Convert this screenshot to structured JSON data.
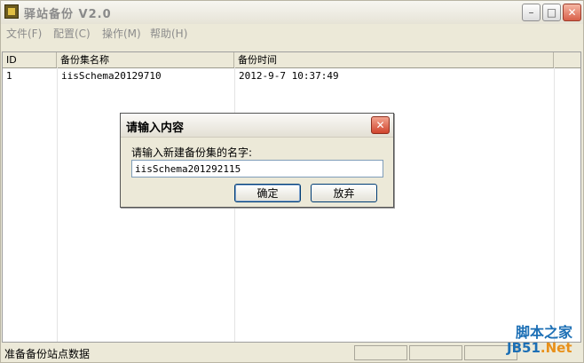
{
  "window": {
    "title": "驿站备份 V2.0"
  },
  "menu": [
    "文件(F)",
    "配置(C)",
    "操作(M)",
    "帮助(H)"
  ],
  "table": {
    "columns": [
      "ID",
      "备份集名称",
      "备份时间"
    ],
    "rows": [
      [
        "1",
        "iisSchema20129710",
        "2012-9-7 10:37:49"
      ]
    ]
  },
  "dialog": {
    "title": "请输入内容",
    "prompt": "请输入新建备份集的名字:",
    "input_value": "iisSchema201292115",
    "ok_label": "确定",
    "cancel_label": "放弃"
  },
  "status": {
    "text": "准备备份站点数据"
  },
  "watermark": {
    "top": "脚本之家",
    "bottom_left": "JB51",
    "bottom_right": ".Net"
  },
  "colors": {
    "watermark_blue": "#1c6fb5",
    "watermark_orange": "#e8901a"
  }
}
